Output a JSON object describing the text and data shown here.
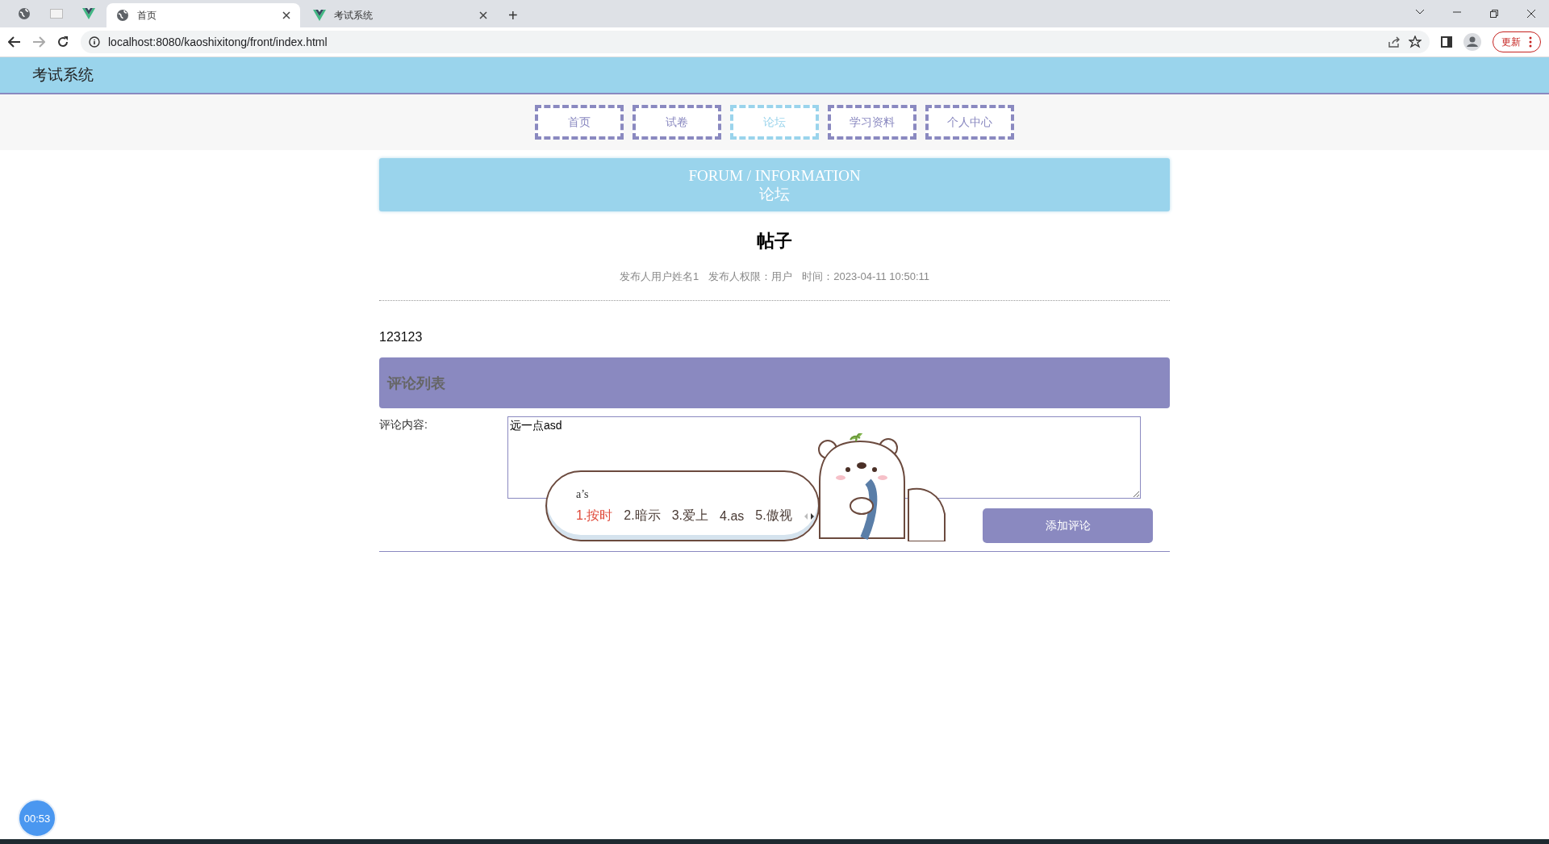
{
  "browser": {
    "tabs": [
      {
        "kind": "globe",
        "title": "首页",
        "selected": true
      },
      {
        "kind": "vue",
        "title": "考试系统",
        "selected": false
      }
    ],
    "new_tab": "+",
    "url": "localhost:8080/kaoshixitong/front/index.html",
    "update_button": "更新"
  },
  "header": {
    "title": "考试系统"
  },
  "nav": [
    {
      "label": "首页",
      "selected": false
    },
    {
      "label": "试卷",
      "selected": false
    },
    {
      "label": "论坛",
      "selected": true
    },
    {
      "label": "学习资料",
      "selected": false
    },
    {
      "label": "个人中心",
      "selected": false
    }
  ],
  "banner": {
    "title": "FORUM / INFORMATION",
    "subtitle": "论坛"
  },
  "post": {
    "title": "帖子",
    "meta": [
      "发布人用户姓名1",
      "发布人权限：用户",
      "时间：2023-04-11 10:50:11"
    ],
    "content": "123123"
  },
  "comments": {
    "heading": "评论列表",
    "label": "评论内容:",
    "value": "远一点asd",
    "submit": "添加评论"
  },
  "ime": {
    "composition": "a’s",
    "candidates": [
      {
        "text": "1.按时",
        "selected": true
      },
      {
        "text": "2.暗示",
        "selected": false
      },
      {
        "text": "3.爱上",
        "selected": false
      },
      {
        "text": "4.as",
        "selected": false
      },
      {
        "text": "5.傲视",
        "selected": false
      }
    ]
  },
  "timer": "00:53"
}
